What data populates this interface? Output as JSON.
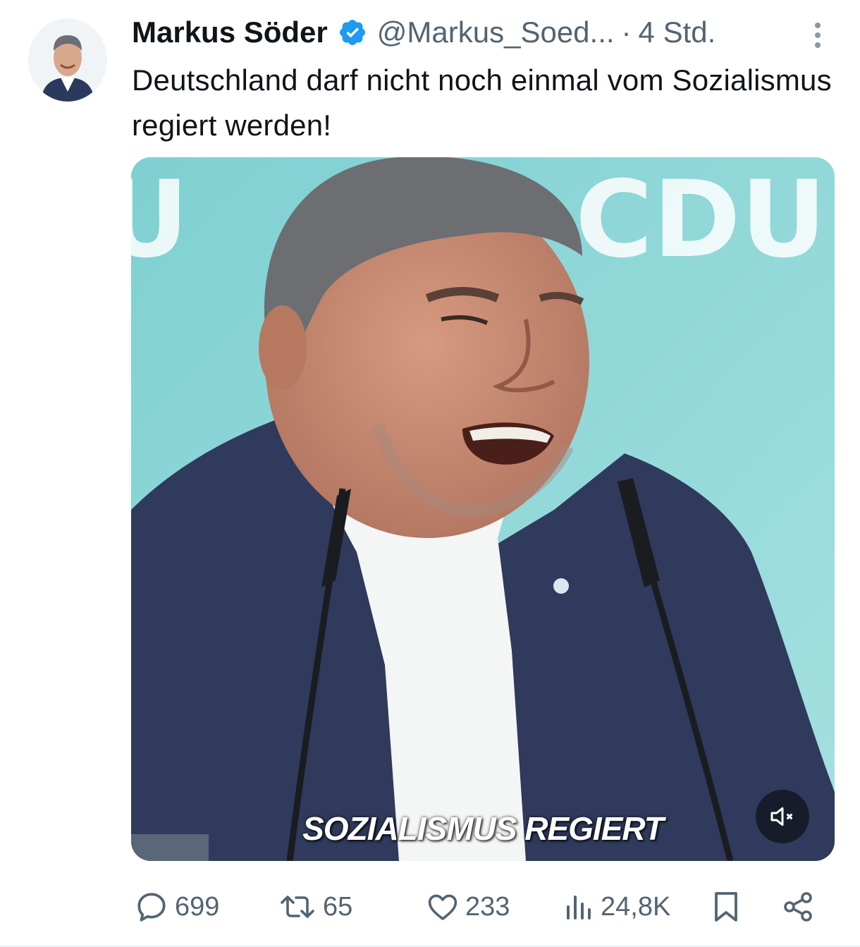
{
  "tweet": {
    "author": {
      "display_name": "Markus Söder",
      "handle": "@Markus_Soed...",
      "verified": true
    },
    "separator": "·",
    "time": "4 Std.",
    "text": "Deutschland darf nicht noch einmal vom Sozialismus regiert werden!"
  },
  "media": {
    "type": "video",
    "caption": "SOZIALISMUS REGIERT",
    "background_text": [
      "U",
      "CDU"
    ],
    "muted": true
  },
  "actions": {
    "replies": "699",
    "reposts": "65",
    "likes": "233",
    "views": "24,8K"
  },
  "icons": {
    "verified": "verified-badge-icon",
    "more": "more-options-icon",
    "reply": "reply-icon",
    "repost": "repost-icon",
    "like": "heart-icon",
    "views": "views-icon",
    "bookmark": "bookmark-icon",
    "share": "share-icon",
    "mute": "volume-muted-icon"
  },
  "colors": {
    "text_primary": "#0f1419",
    "text_secondary": "#536471",
    "verified_blue": "#1d9bf0",
    "stage_background": "#9ad9da"
  }
}
